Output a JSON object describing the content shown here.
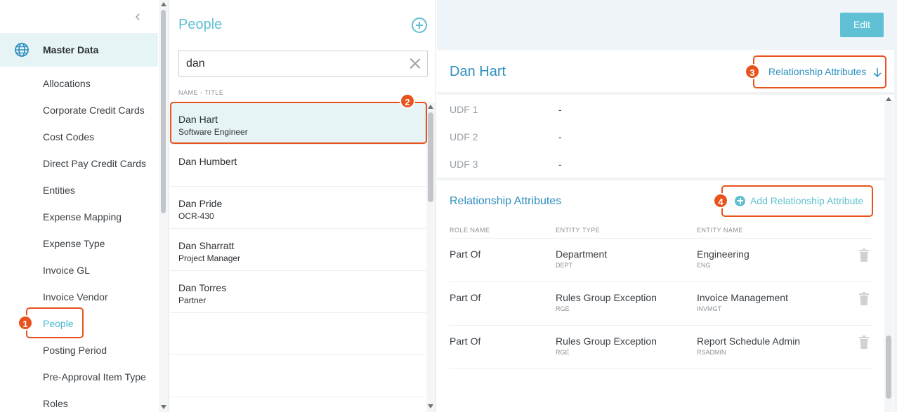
{
  "sidebar": {
    "collapse_glyph": "‹",
    "section_title": "Master Data",
    "section_icon": "globe-icon",
    "items": [
      {
        "label": "Allocations"
      },
      {
        "label": "Corporate Credit Cards"
      },
      {
        "label": "Cost Codes"
      },
      {
        "label": "Direct Pay Credit Cards"
      },
      {
        "label": "Entities"
      },
      {
        "label": "Expense Mapping"
      },
      {
        "label": "Expense Type"
      },
      {
        "label": "Invoice GL"
      },
      {
        "label": "Invoice Vendor"
      },
      {
        "label": "People",
        "active": true
      },
      {
        "label": "Posting Period"
      },
      {
        "label": "Pre-Approval Item Type"
      },
      {
        "label": "Roles"
      }
    ]
  },
  "people_panel": {
    "title": "People",
    "search_value": "dan",
    "column_header": "NAME  -  TITLE",
    "people": [
      {
        "name": "Dan Hart",
        "title": "Software Engineer",
        "selected": true
      },
      {
        "name": "Dan Humbert",
        "title": ""
      },
      {
        "name": "Dan Pride",
        "title": "OCR-430"
      },
      {
        "name": "Dan Sharratt",
        "title": "Project Manager"
      },
      {
        "name": "Dan Torres",
        "title": "Partner"
      }
    ]
  },
  "detail": {
    "edit_label": "Edit",
    "name": "Dan Hart",
    "relationship_link": "Relationship Attributes",
    "udfs": [
      {
        "label": "UDF 1",
        "value": "-"
      },
      {
        "label": "UDF 2",
        "value": "-"
      },
      {
        "label": "UDF 3",
        "value": "-"
      }
    ],
    "relationship_section_title": "Relationship Attributes",
    "add_relationship_label": "Add Relationship Attribute",
    "columns": {
      "role": "ROLE NAME",
      "entity_type": "ENTITY TYPE",
      "entity_name": "ENTITY NAME"
    },
    "relationships": [
      {
        "role": "Part Of",
        "entity_type": "Department",
        "entity_type_code": "DEPT",
        "entity_name": "Engineering",
        "entity_code": "ENG"
      },
      {
        "role": "Part Of",
        "entity_type": "Rules Group Exception",
        "entity_type_code": "RGE",
        "entity_name": "Invoice Management",
        "entity_code": "INVMGT"
      },
      {
        "role": "Part Of",
        "entity_type": "Rules Group Exception",
        "entity_type_code": "RGE",
        "entity_name": "Report Schedule Admin",
        "entity_code": "RSADMIN"
      }
    ]
  },
  "annotations": [
    {
      "number": "1"
    },
    {
      "number": "2"
    },
    {
      "number": "3"
    },
    {
      "number": "4"
    }
  ],
  "colors": {
    "accent": "#5fbfd0",
    "link": "#2f8fc0",
    "callout": "#e8521c",
    "selected_bg": "#e6f4f6"
  }
}
